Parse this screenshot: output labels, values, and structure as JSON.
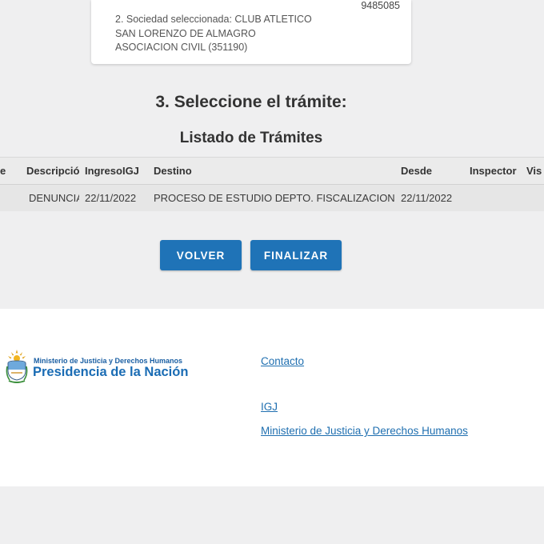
{
  "summary_card": {
    "number": "9485085",
    "society_line": "2. Sociedad seleccionada: CLUB ATLETICO SAN LORENZO DE ALMAGRO ASOCIACION CIVIL (351190)"
  },
  "step_title": "3. Seleccione el trámite:",
  "list_title": "Listado de Trámites",
  "table": {
    "headers": [
      "e",
      "Descripción",
      "IngresoIGJ",
      "Destino",
      "Desde",
      "Inspector",
      "Vis"
    ],
    "rows": [
      [
        "",
        "DENUNCIA",
        "22/11/2022",
        "PROCESO DE ESTUDIO DEPTO. FISCALIZACION--",
        "22/11/2022",
        "",
        ""
      ]
    ]
  },
  "buttons": {
    "back": "VOLVER",
    "finish": "FINALIZAR"
  },
  "footer": {
    "logo_small": "Ministerio de Justicia y Derechos Humanos",
    "logo_big": "Presidencia de la Nación",
    "links": [
      "Contacto",
      "IGJ",
      "Ministerio de Justicia y Derechos Humanos"
    ]
  },
  "colors": {
    "primary_button": "#1f73b7",
    "link": "#1f6fb0",
    "background": "#efeff0"
  },
  "icons": {
    "logo": "argentina-coat-of-arms-icon"
  }
}
